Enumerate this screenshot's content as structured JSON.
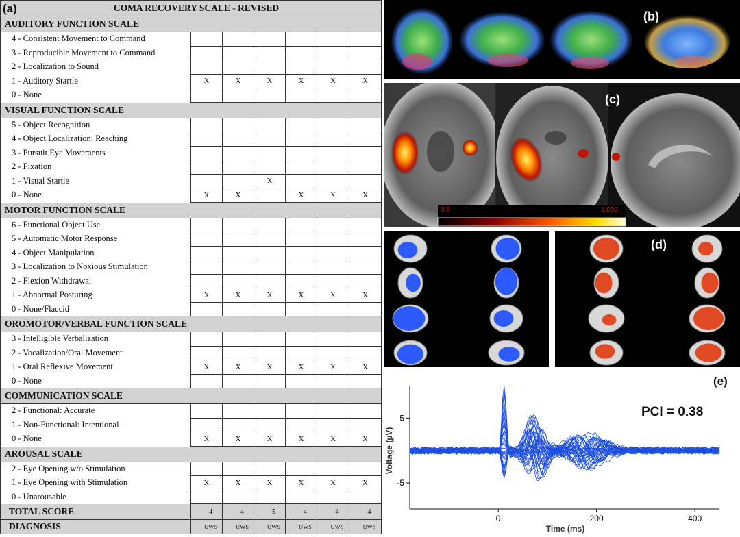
{
  "panel_a": {
    "tag": "(a)",
    "title": "COMA RECOVERY SCALE - REVISED",
    "sections": [
      {
        "name": "AUDITORY FUNCTION SCALE",
        "items": [
          {
            "label": "4 - Consistent Movement to Command",
            "marks": [
              "",
              "",
              "",
              "",
              "",
              ""
            ]
          },
          {
            "label": "3 - Reproducible Movement to Command",
            "marks": [
              "",
              "",
              "",
              "",
              "",
              ""
            ]
          },
          {
            "label": "2 - Localization to Sound",
            "marks": [
              "",
              "",
              "",
              "",
              "",
              ""
            ]
          },
          {
            "label": "1 - Auditory Startle",
            "marks": [
              "X",
              "X",
              "X",
              "X",
              "X",
              "X"
            ]
          },
          {
            "label": "0 - None",
            "marks": [
              "",
              "",
              "",
              "",
              "",
              ""
            ]
          }
        ]
      },
      {
        "name": "VISUAL FUNCTION SCALE",
        "items": [
          {
            "label": "5 - Object Recognition",
            "marks": [
              "",
              "",
              "",
              "",
              "",
              ""
            ]
          },
          {
            "label": "4 - Object Localization: Reaching",
            "marks": [
              "",
              "",
              "",
              "",
              "",
              ""
            ]
          },
          {
            "label": "3 - Pursuit Eye Movements",
            "marks": [
              "",
              "",
              "",
              "",
              "",
              ""
            ]
          },
          {
            "label": "2 - Fixation",
            "marks": [
              "",
              "",
              "",
              "",
              "",
              ""
            ]
          },
          {
            "label": "1 - Visual Startle",
            "marks": [
              "",
              "",
              "X",
              "",
              "",
              ""
            ]
          },
          {
            "label": "0 - None",
            "marks": [
              "X",
              "X",
              "",
              "X",
              "X",
              "X"
            ]
          }
        ]
      },
      {
        "name": "MOTOR FUNCTION SCALE",
        "items": [
          {
            "label": "6 - Functional Object Use",
            "marks": [
              "",
              "",
              "",
              "",
              "",
              ""
            ]
          },
          {
            "label": "5 - Automatic Motor Response",
            "marks": [
              "",
              "",
              "",
              "",
              "",
              ""
            ]
          },
          {
            "label": "4 - Object Manipulation",
            "marks": [
              "",
              "",
              "",
              "",
              "",
              ""
            ]
          },
          {
            "label": "3 - Localization to Noxious Stimulation",
            "marks": [
              "",
              "",
              "",
              "",
              "",
              ""
            ]
          },
          {
            "label": "2 - Flexion Withdrawal",
            "marks": [
              "",
              "",
              "",
              "",
              "",
              ""
            ]
          },
          {
            "label": "1 - Abnormal Posturing",
            "marks": [
              "X",
              "X",
              "X",
              "X",
              "X",
              "X"
            ]
          },
          {
            "label": "0 - None/Flaccid",
            "marks": [
              "",
              "",
              "",
              "",
              "",
              ""
            ]
          }
        ]
      },
      {
        "name": "OROMOTOR/VERBAL FUNCTION SCALE",
        "items": [
          {
            "label": "3 - Intelligible Verbalization",
            "marks": [
              "",
              "",
              "",
              "",
              "",
              ""
            ]
          },
          {
            "label": "2 - Vocalization/Oral Movement",
            "marks": [
              "",
              "",
              "",
              "",
              "",
              ""
            ]
          },
          {
            "label": "1 - Oral Reflexive Movement",
            "marks": [
              "X",
              "X",
              "X",
              "X",
              "X",
              "X"
            ]
          },
          {
            "label": "0 - None",
            "marks": [
              "",
              "",
              "",
              "",
              "",
              ""
            ]
          }
        ]
      },
      {
        "name": "COMMUNICATION SCALE",
        "items": [
          {
            "label": "2 - Functional: Accurate",
            "marks": [
              "",
              "",
              "",
              "",
              "",
              ""
            ]
          },
          {
            "label": "1 - Non-Functional: Intentional",
            "marks": [
              "",
              "",
              "",
              "",
              "",
              ""
            ]
          },
          {
            "label": "0 - None",
            "marks": [
              "X",
              "X",
              "X",
              "X",
              "X",
              "X"
            ]
          }
        ]
      },
      {
        "name": "AROUSAL SCALE",
        "items": [
          {
            "label": "2 - Eye Opening w/o Stimulation",
            "marks": [
              "",
              "",
              "",
              "",
              "",
              ""
            ]
          },
          {
            "label": "1 - Eye Opening with Stimulation",
            "marks": [
              "X",
              "X",
              "X",
              "X",
              "X",
              "X"
            ]
          },
          {
            "label": "0 - Unarousable",
            "marks": [
              "",
              "",
              "",
              "",
              "",
              ""
            ]
          }
        ]
      }
    ],
    "total_label": "TOTAL SCORE",
    "totals": [
      "4",
      "4",
      "5",
      "4",
      "4",
      "4"
    ],
    "diagnosis_label": "DIAGNOSIS",
    "diagnoses": [
      "UWS",
      "UWS",
      "UWS",
      "UWS",
      "UWS",
      "UWS"
    ]
  },
  "panel_b": {
    "tag": "(b)"
  },
  "panel_c": {
    "tag": "(c)",
    "scale_min": "0.5",
    "scale_max": "1.002"
  },
  "panel_d": {
    "tag": "(d)"
  },
  "panel_e": {
    "tag": "(e)",
    "annotation": "PCI = 0.38",
    "chart_data": {
      "type": "line",
      "xlabel": "Time (ms)",
      "ylabel": "Voltage (µV)",
      "xticks": [
        "0",
        "200",
        "400"
      ],
      "yticks": [
        "5",
        "-5"
      ],
      "xlim": [
        -180,
        450
      ],
      "ylim": [
        -9,
        10
      ],
      "grid": false
    }
  },
  "colors": {
    "header_bg": "#d2d2d2",
    "trace": "#1f4fe0",
    "activation_hot": "#ff4d00"
  }
}
